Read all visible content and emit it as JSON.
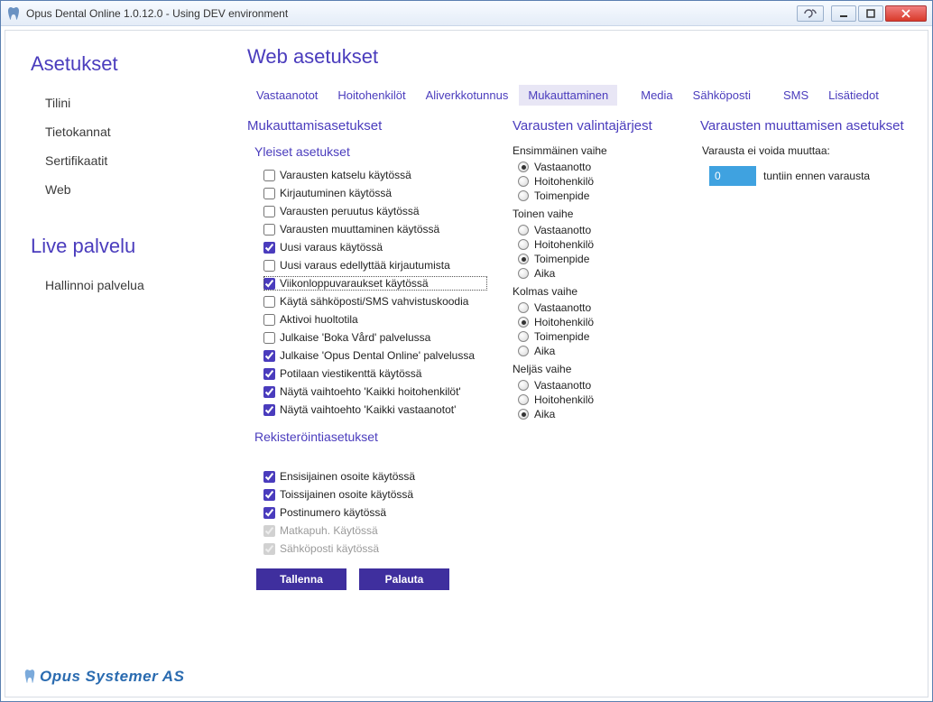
{
  "window": {
    "title": "Opus Dental Online 1.0.12.0 - Using DEV environment"
  },
  "sidebar": {
    "groups": [
      {
        "head": "Asetukset",
        "items": [
          "Tilini",
          "Tietokannat",
          "Sertifikaatit",
          "Web"
        ]
      },
      {
        "head": "Live palvelu",
        "items": [
          "Hallinnoi palvelua"
        ]
      }
    ]
  },
  "main": {
    "title": "Web asetukset",
    "tabs": [
      "Vastaanotot",
      "Hoitohenkilöt",
      "Aliverkkotunnus",
      "Mukauttaminen",
      "Media",
      "Sähköposti",
      "SMS",
      "Lisätiedot"
    ],
    "active_tab": 3,
    "col1": {
      "head": "Mukauttamisasetukset",
      "general_head": "Yleiset asetukset",
      "general": [
        {
          "label": "Varausten katselu käytössä",
          "checked": false
        },
        {
          "label": "Kirjautuminen käytössä",
          "checked": false
        },
        {
          "label": "Varausten peruutus käytössä",
          "checked": false
        },
        {
          "label": "Varausten muuttaminen käytössä",
          "checked": false
        },
        {
          "label": "Uusi varaus käytössä",
          "checked": true
        },
        {
          "label": "Uusi varaus edellyttää kirjautumista",
          "checked": false
        },
        {
          "label": "Viikonloppuvaraukset käytössä",
          "checked": true,
          "focused": true
        },
        {
          "label": "Käytä sähköposti/SMS vahvistuskoodia",
          "checked": false
        },
        {
          "label": "Aktivoi huoltotila",
          "checked": false
        },
        {
          "label": "Julkaise 'Boka Vård' palvelussa",
          "checked": false
        },
        {
          "label": "Julkaise 'Opus Dental Online' palvelussa",
          "checked": true
        },
        {
          "label": "Potilaan viestikenttä käytössä",
          "checked": true
        },
        {
          "label": "Näytä vaihtoehto 'Kaikki hoitohenkilöt'",
          "checked": true
        },
        {
          "label": "Näytä vaihtoehto 'Kaikki vastaanotot'",
          "checked": true
        }
      ],
      "reg_head": "Rekisteröintiasetukset",
      "reg": [
        {
          "label": "Ensisijainen osoite käytössä",
          "checked": true
        },
        {
          "label": "Toissijainen osoite käytössä",
          "checked": true
        },
        {
          "label": "Postinumero käytössä",
          "checked": true
        },
        {
          "label": "Matkapuh. Käytössä",
          "checked": true,
          "disabled": true
        },
        {
          "label": "Sähköposti käytössä",
          "checked": true,
          "disabled": true
        }
      ],
      "save_label": "Tallenna",
      "reset_label": "Palauta"
    },
    "col2": {
      "head": "Varausten valintajärjest",
      "phases": [
        {
          "title": "Ensimmäinen vaihe",
          "options": [
            {
              "label": "Vastaanotto",
              "selected": true
            },
            {
              "label": "Hoitohenkilö",
              "selected": false
            },
            {
              "label": "Toimenpide",
              "selected": false
            }
          ]
        },
        {
          "title": "Toinen vaihe",
          "options": [
            {
              "label": "Vastaanotto",
              "selected": false
            },
            {
              "label": "Hoitohenkilö",
              "selected": false
            },
            {
              "label": "Toimenpide",
              "selected": true
            },
            {
              "label": "Aika",
              "selected": false
            }
          ]
        },
        {
          "title": "Kolmas vaihe",
          "options": [
            {
              "label": "Vastaanotto",
              "selected": false
            },
            {
              "label": "Hoitohenkilö",
              "selected": true
            },
            {
              "label": "Toimenpide",
              "selected": false
            },
            {
              "label": "Aika",
              "selected": false
            }
          ]
        },
        {
          "title": "Neljäs vaihe",
          "options": [
            {
              "label": "Vastaanotto",
              "selected": false
            },
            {
              "label": "Hoitohenkilö",
              "selected": false
            },
            {
              "label": "Aika",
              "selected": true
            }
          ]
        }
      ]
    },
    "col3": {
      "head": "Varausten muuttamisen asetukset",
      "cannot_modify_label": "Varausta ei voida muuttaa:",
      "hours_value": "0",
      "hours_suffix": "tuntiin ennen varausta"
    }
  },
  "footer": {
    "company": "Opus Systemer AS"
  }
}
